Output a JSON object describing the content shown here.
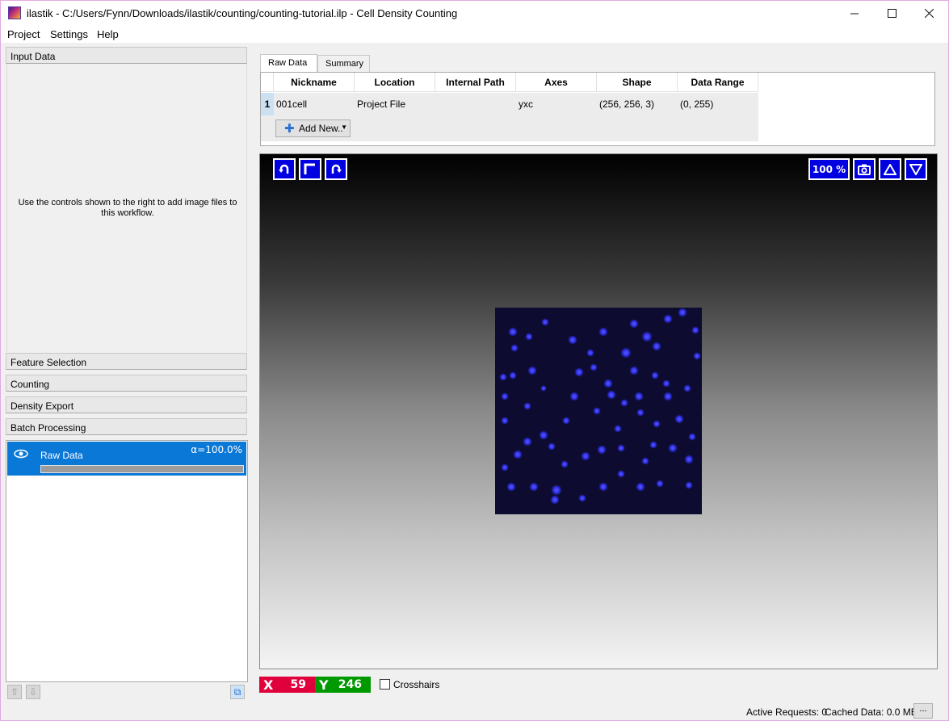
{
  "window": {
    "title": "ilastik - C:/Users/Fynn/Downloads/ilastik/counting/counting-tutorial.ilp - Cell Density Counting",
    "minimize": "—",
    "maximize": "☐",
    "close": "✕"
  },
  "menu": {
    "project": "Project",
    "settings": "Settings",
    "help": "Help"
  },
  "applets": {
    "input_data": "Input Data",
    "input_data_help": "Use the controls shown to the right to add image files to this workflow.",
    "feature_selection": "Feature Selection",
    "counting": "Counting",
    "density_export": "Density Export",
    "batch_processing": "Batch Processing"
  },
  "layers": [
    {
      "name": "Raw Data",
      "opacity_label": "α=100.0%",
      "opacity": 1.0,
      "visible": true
    }
  ],
  "tabs": [
    {
      "label": "Raw Data",
      "active": true
    },
    {
      "label": "Summary",
      "active": false
    }
  ],
  "table": {
    "headers": [
      "Nickname",
      "Location",
      "Internal Path",
      "Axes",
      "Shape",
      "Data Range"
    ],
    "rows": [
      {
        "index": "1",
        "cells": [
          "001cell",
          "Project File",
          "",
          "yxc",
          "(256, 256, 3)",
          "(0, 255)"
        ]
      }
    ],
    "add_button": "Add New.."
  },
  "viewer": {
    "zoom_label": "100 %",
    "tools": [
      "rotate-left-icon",
      "fit-icon",
      "rotate-right-icon",
      "camera-icon",
      "slice-up-icon",
      "slice-down-icon"
    ]
  },
  "coords": {
    "x_label": "X",
    "x_value": "59",
    "y_label": "Y",
    "y_value": "246",
    "crosshairs_label": "Crosshairs",
    "crosshairs_checked": false
  },
  "status": {
    "active_requests": "Active Requests: 0",
    "cached_data": "Cached Data: 0.0 MB",
    "more_button": "..."
  },
  "colors": {
    "selection": "#0a78d7",
    "viewer_button": "#0000e0",
    "x_coord": "#e0003c",
    "y_coord": "#009900",
    "window_border": "#e4a9e2"
  }
}
